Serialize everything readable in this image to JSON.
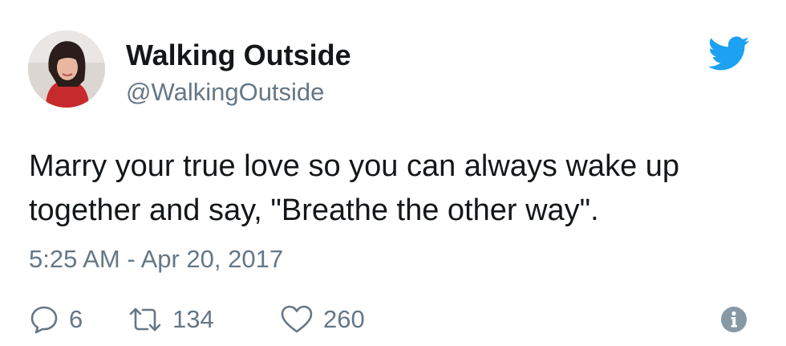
{
  "user": {
    "display_name": "Walking Outside",
    "handle": "@WalkingOutside",
    "avatar_icon": "profile-photo"
  },
  "tweet": {
    "lines": [
      "Marry your true love so you can always wake up",
      "together and say, \"Breathe the other way\"."
    ],
    "timestamp": "5:25 AM - Apr 20, 2017"
  },
  "actions": {
    "replies": "6",
    "retweets": "134",
    "likes": "260"
  },
  "icons": {
    "brand": "twitter-bird-icon",
    "reply": "reply-icon",
    "retweet": "retweet-icon",
    "like": "heart-icon",
    "info": "info-icon"
  },
  "colors": {
    "brand": "#1DA1F2",
    "secondary_text": "#657786",
    "primary_text": "#14171A"
  }
}
